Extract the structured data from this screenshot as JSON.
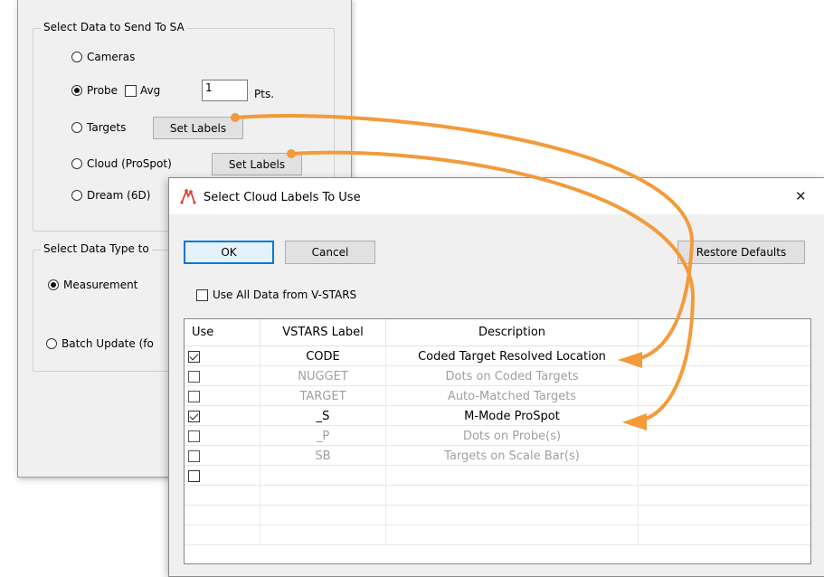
{
  "bg_dialog": {
    "group_send": {
      "title": "Select Data to Send To SA",
      "options": {
        "cameras": "Cameras",
        "probe": "Probe",
        "avg": "Avg",
        "avg_value": "1",
        "pts": "Pts.",
        "targets": "Targets",
        "cloud": "Cloud (ProSpot)",
        "dream": "Dream (6D)"
      },
      "set_labels_1": "Set Labels",
      "set_labels_2": "Set Labels"
    },
    "group_type": {
      "title": "Select Data Type to",
      "measurement": "Measurement",
      "batch_update": "Batch Update (fo"
    }
  },
  "dialog": {
    "title": "Select Cloud Labels To Use",
    "close_glyph": "✕",
    "ok": "OK",
    "cancel": "Cancel",
    "restore_defaults": "Restore Defaults",
    "use_all_label": "Use All Data from V-STARS",
    "use_all_checked": false,
    "table": {
      "headers": [
        "Use",
        "VSTARS Label",
        "Description"
      ],
      "rows": [
        {
          "checked": true,
          "label": "CODE",
          "description": "Coded Target Resolved Location",
          "enabled": true
        },
        {
          "checked": false,
          "label": "NUGGET",
          "description": "Dots on Coded Targets",
          "enabled": false
        },
        {
          "checked": false,
          "label": "TARGET",
          "description": "Auto-Matched Targets",
          "enabled": false
        },
        {
          "checked": true,
          "label": "_S",
          "description": "M-Mode ProSpot",
          "enabled": true
        },
        {
          "checked": false,
          "label": "_P",
          "description": "Dots on Probe(s)",
          "enabled": false
        },
        {
          "checked": false,
          "label": "SB",
          "description": "Targets on Scale Bar(s)",
          "enabled": false
        },
        {
          "checked": false,
          "label": "",
          "description": "",
          "enabled": true
        }
      ]
    }
  },
  "colors": {
    "annotation_arrow": "#f39a3b",
    "selection_accent": "#0078d7"
  }
}
